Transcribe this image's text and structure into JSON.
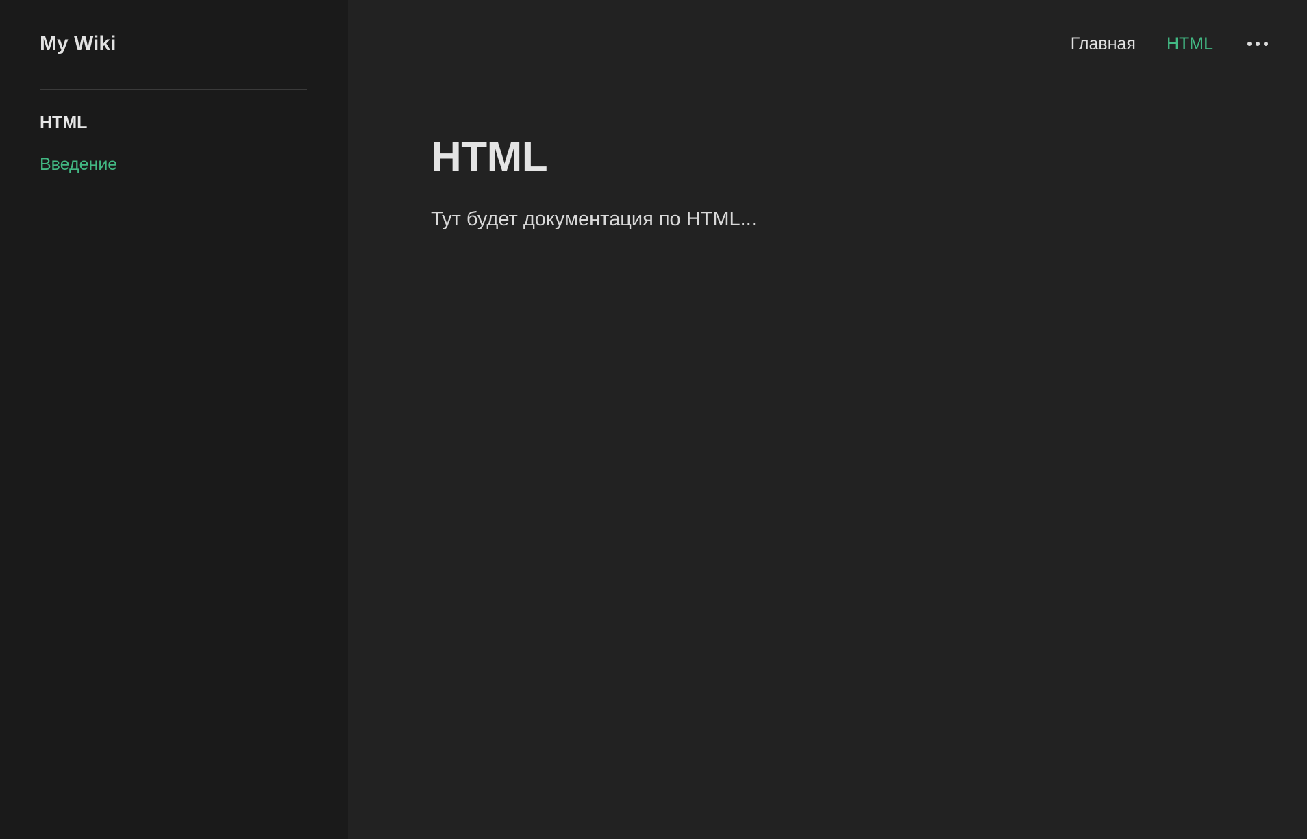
{
  "sidebar": {
    "site_title": "My Wiki",
    "group_title": "HTML",
    "items": [
      {
        "label": "Введение"
      }
    ]
  },
  "topnav": {
    "items": [
      {
        "label": "Главная",
        "active": false
      },
      {
        "label": "HTML",
        "active": true
      }
    ],
    "more_icon": "more-horizontal-icon"
  },
  "main": {
    "title": "HTML",
    "text": "Тут будет документация по HTML..."
  },
  "colors": {
    "accent": "#42b883",
    "sidebar_bg": "#1a1a1a",
    "main_bg": "#222222",
    "text": "#e2e2e2"
  }
}
